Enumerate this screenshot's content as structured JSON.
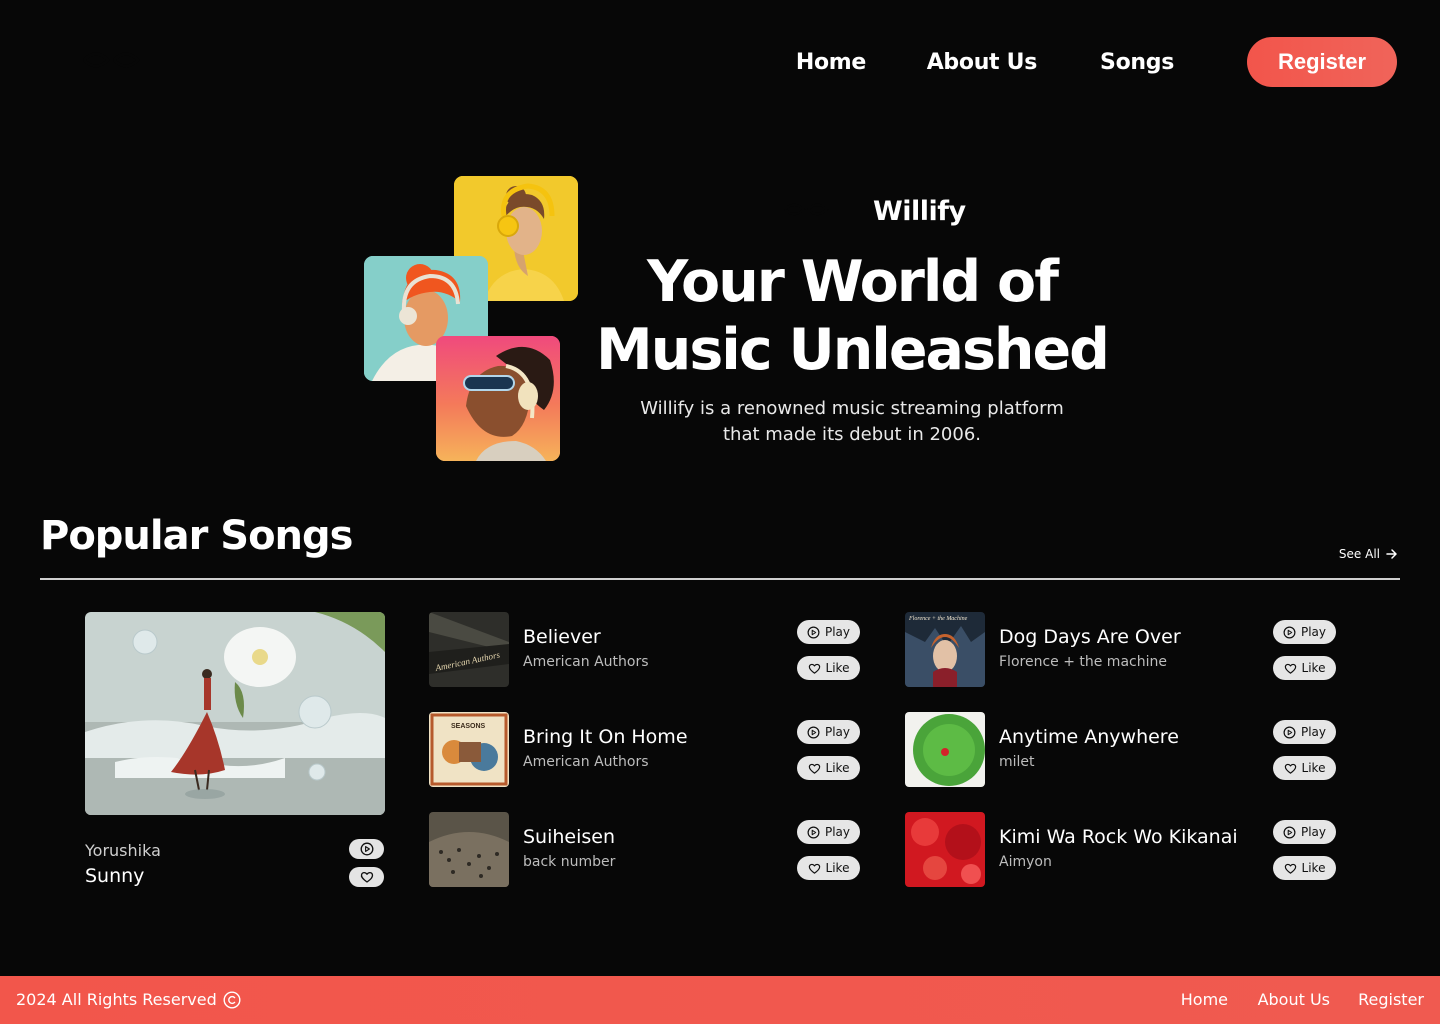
{
  "nav": {
    "home": "Home",
    "about": "About Us",
    "songs": "Songs",
    "register": "Register"
  },
  "hero": {
    "brand": "Willify",
    "title_line1": "Your World of",
    "title_line2": "Music Unleashed",
    "subtitle_line1": "Willify is a renowned music streaming platform",
    "subtitle_line2": "that made its debut in 2006."
  },
  "popular": {
    "title": "Popular Songs",
    "see_all": "See All",
    "featured": {
      "artist": "Yorushika",
      "title": "Sunny"
    },
    "play_label": "Play",
    "like_label": "Like",
    "songs": [
      {
        "title": "Believer",
        "artist": "American Authors"
      },
      {
        "title": "Bring It On Home",
        "artist": "American Authors"
      },
      {
        "title": "Suiheisen",
        "artist": "back number"
      },
      {
        "title": "Dog Days Are Over",
        "artist": "Florence + the machine"
      },
      {
        "title": "Anytime Anywhere",
        "artist": "milet"
      },
      {
        "title": "Kimi Wa Rock Wo Kikanai",
        "artist": "Aimyon"
      }
    ]
  },
  "footer": {
    "copyright": "2024 All Rights Reserved",
    "home": "Home",
    "about": "About Us",
    "register": "Register"
  },
  "colors": {
    "accent": "#f2564b",
    "background": "#070707"
  },
  "icons": [
    "waveform-logo-icon",
    "play-circle-icon",
    "heart-icon",
    "arrow-right-icon",
    "copyright-icon"
  ]
}
